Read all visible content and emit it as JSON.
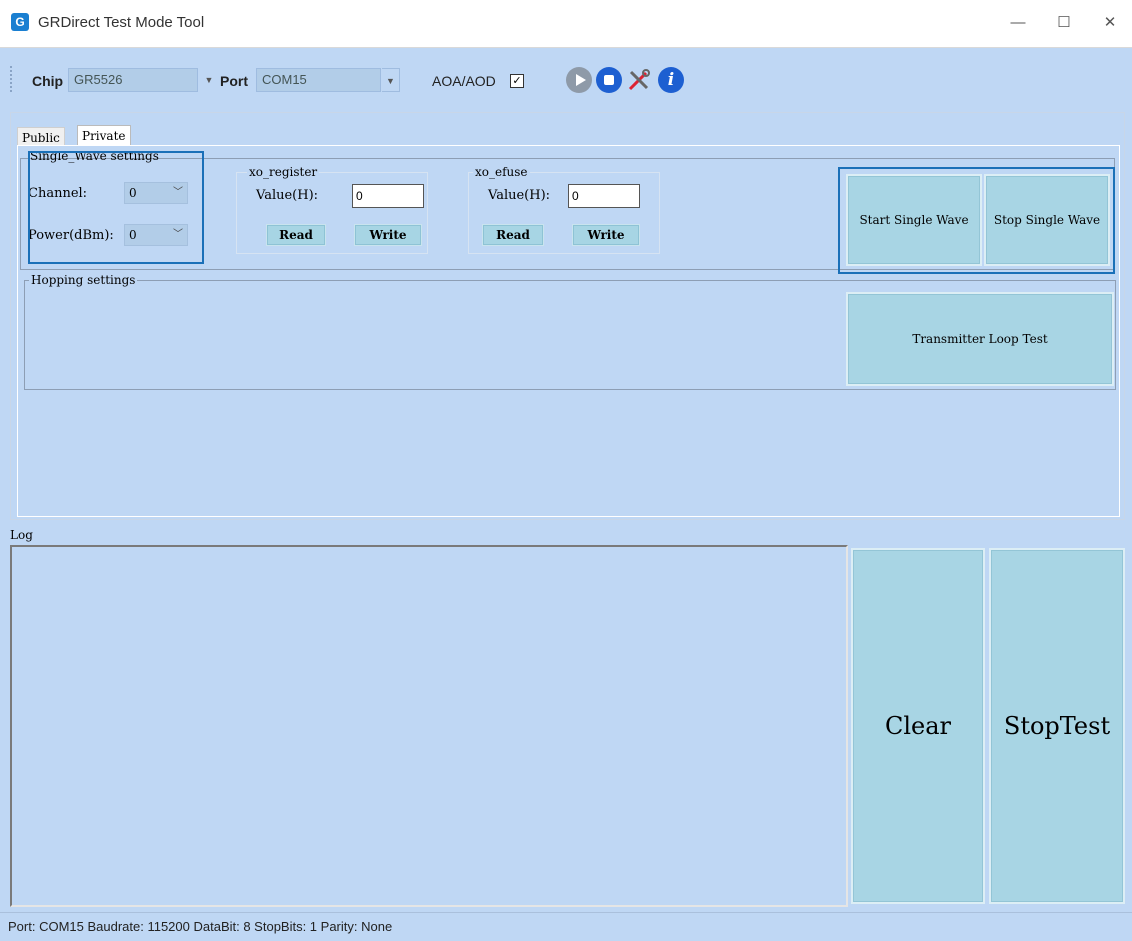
{
  "window": {
    "title": "GRDirect Test Mode Tool",
    "app_icon_text": "G",
    "minimize": "—",
    "maximize": "☐",
    "close": "✕"
  },
  "toolbar": {
    "chip_label": "Chip",
    "chip_value": "GR5526",
    "port_label": "Port",
    "port_value": "COM15",
    "aoa_label": "AOA/AOD",
    "aoa_checked": "✓",
    "icons": [
      "play-icon",
      "stop-icon",
      "tools-icon",
      "info-icon"
    ],
    "info_glyph": "i"
  },
  "tabs": [
    {
      "label": "Public"
    },
    {
      "label": "Private"
    }
  ],
  "single_wave": {
    "legend": "Single_Wave settings",
    "channel_label": "Channel:",
    "channel_value": "0",
    "power_label": "Power(dBm):",
    "power_value": "0"
  },
  "xo_register": {
    "legend": "xo_register",
    "value_label": "Value(H):",
    "value": "0",
    "read": "Read",
    "write": "Write"
  },
  "xo_efuse": {
    "legend": "xo_efuse",
    "value_label": "Value(H):",
    "value": "0",
    "read": "Read",
    "write": "Write"
  },
  "wave_buttons": {
    "start": "Start Single Wave",
    "stop": "Stop Single Wave"
  },
  "hopping": {
    "legend": "Hopping settings",
    "loop_test": "Transmitter Loop Test"
  },
  "log": {
    "label": "Log",
    "clear": "Clear",
    "stop_test": "StopTest"
  },
  "status": {
    "text": "Port: COM15  Baudrate: 115200  DataBit: 8  StopBits: 1  Parity: None"
  },
  "colors": {
    "panel_bg": "#bfd7f4",
    "button_bg": "#a8d5e4",
    "highlight": "#1a70b8"
  }
}
